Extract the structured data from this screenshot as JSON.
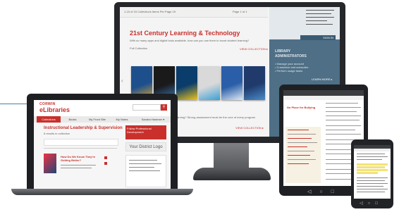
{
  "monitor": {
    "topbar_text": "1-15 of 15 Collections   Items Per Page  15",
    "topbar_page": "Page  1  of 1",
    "title": "21st Century Learning & Technology",
    "description": "With so many apps and digital tools available, how can you use them to boost student learning?",
    "full_collection": "Full Collection",
    "view_collection": "VIEW COLLECTION ▸",
    "side_button": "SIGN IN",
    "admin_heading_1": "LIBRARY",
    "admin_heading_2": "ADMINISTRATORS",
    "admin_items": [
      "• Manage your account",
      "• Customize and subscribe",
      "• Perform usage tasks"
    ],
    "learn_more": "LEARN MORE ▸",
    "bottom_question": "learning? Strong assessment must be the core of every program",
    "view_collection_2": "VIEW COLLECTION ▸",
    "books": [
      {
        "c1": "#1d4f8c",
        "c2": "#e3a92b"
      },
      {
        "c1": "#1a1a1a",
        "c2": "#3b7bc0"
      },
      {
        "c1": "#0a3d6b",
        "c2": "#f0c419"
      },
      {
        "c1": "#d9d9d9",
        "c2": "#3aa0d6"
      },
      {
        "c1": "#2a5ea8",
        "c2": "#dfe9f4"
      },
      {
        "c1": "#1f3a6b",
        "c2": "#4a8cc9"
      }
    ]
  },
  "laptop": {
    "logo_top": "CORWIN",
    "logo": "eLibraries",
    "nav": [
      "Collections",
      "Books",
      "My Front Site",
      "My Notes"
    ],
    "nav_right": "Sandra Hammer ▾",
    "content_title": "Instructional Leadership & Supervision",
    "subtitle": "8 results in collection",
    "promo": "Follow Professional Development",
    "district_logo": "Your District Logo",
    "book_title": "How Do We Know They're Getting Better?"
  },
  "tablet": {
    "title": "No Place for Bullying"
  },
  "colors": {
    "accent": "#c9302c",
    "sidebar": "#4e6f86",
    "device": "#1f2023"
  }
}
